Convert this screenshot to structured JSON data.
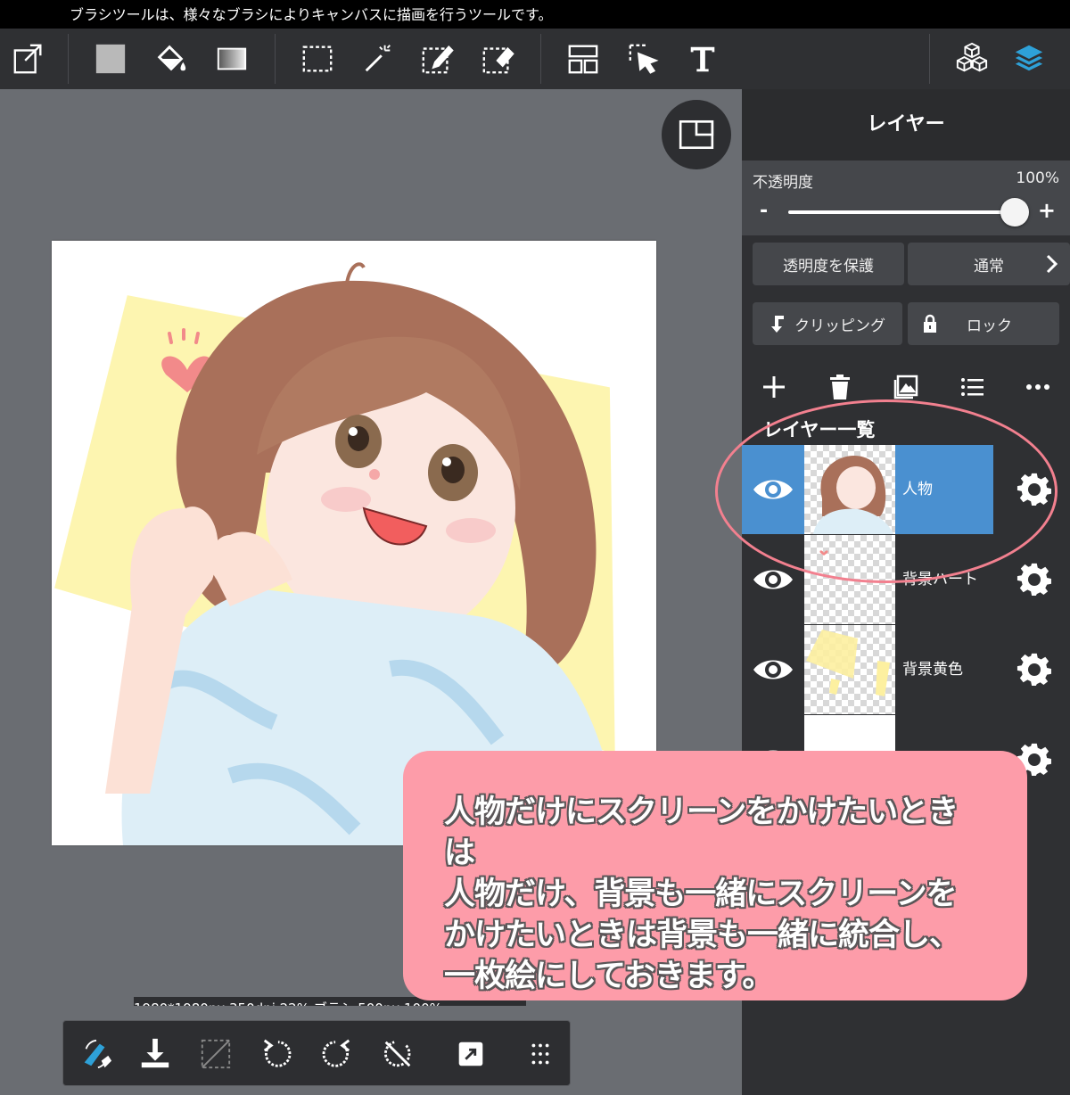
{
  "hint_bar": {
    "text": "ブラシツールは、様々なブラシによりキャンバスに描画を行うツールです。"
  },
  "toolbar": {
    "icons": [
      "export-icon",
      "color-square-icon",
      "fill-bucket-icon",
      "gradient-icon",
      "rect-select-icon",
      "magic-wand-icon",
      "select-pen-icon",
      "select-eraser-icon",
      "layout-icon",
      "move-cursor-icon",
      "text-icon",
      "materials-icon",
      "layers-icon"
    ],
    "accent": "#2ea1d8"
  },
  "status_bar": {
    "text": "1980*1980px 350dpi 22% ブラシ 500px 100%"
  },
  "panel": {
    "title": "レイヤー",
    "opacity_label": "不透明度",
    "opacity_value": "100%",
    "opacity_fraction": 1.0,
    "minus": "-",
    "plus": "+",
    "protect_alpha": "透明度を保護",
    "blend_mode": "通常",
    "clipping": "クリッピング",
    "lock": "ロック",
    "list_header": "レイヤー一覧",
    "layers": [
      {
        "name": "人物",
        "selected": true
      },
      {
        "name": "背景ハート",
        "selected": false
      },
      {
        "name": "背景黄色",
        "selected": false
      },
      {
        "name": "",
        "selected": false
      }
    ],
    "selected_color": "#4a90d0"
  },
  "callout": {
    "lines": [
      "人物だけにスクリーンをかけたいときは",
      "人物だけ、背景も一緒にスクリーンを",
      "かけたいときは背景も一緒に統合し、",
      "一枚絵にしておきます。"
    ],
    "color": "#fd9ca9"
  }
}
